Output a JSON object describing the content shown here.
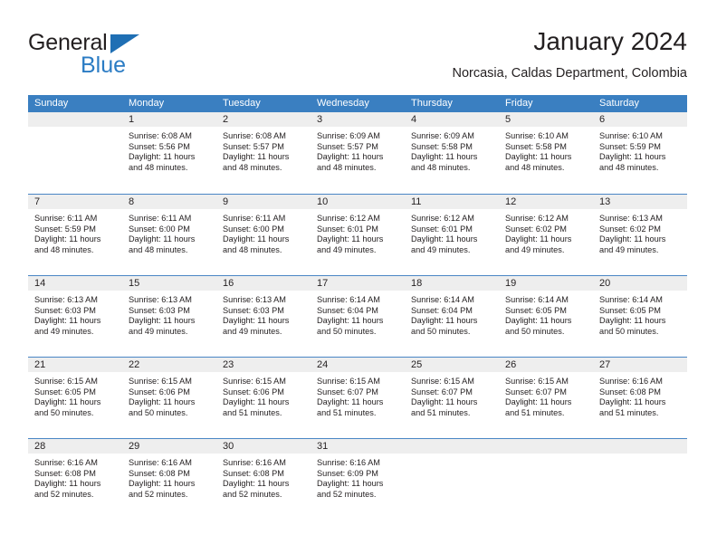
{
  "brand": {
    "name_top": "General",
    "name_bottom": "Blue",
    "triangle_icon": "brand-triangle-icon",
    "color_dark": "#231f20",
    "color_blue": "#2b7cc4"
  },
  "header": {
    "title": "January 2024",
    "subtitle": "Norcasia, Caldas Department, Colombia"
  },
  "theme": {
    "header_blue": "#3a7fc1",
    "row_divider_blue": "#4a86c5",
    "day_strip_gray": "#eeeeee",
    "text": "#231f20"
  },
  "calendar": {
    "weekday_headers": [
      "Sunday",
      "Monday",
      "Tuesday",
      "Wednesday",
      "Thursday",
      "Friday",
      "Saturday"
    ],
    "weeks": [
      [
        {
          "day": "",
          "empty": true,
          "sunrise": "",
          "sunset": "",
          "daylight_line1": "",
          "daylight_line2": ""
        },
        {
          "day": "1",
          "sunrise": "Sunrise: 6:08 AM",
          "sunset": "Sunset: 5:56 PM",
          "daylight_line1": "Daylight: 11 hours",
          "daylight_line2": "and 48 minutes."
        },
        {
          "day": "2",
          "sunrise": "Sunrise: 6:08 AM",
          "sunset": "Sunset: 5:57 PM",
          "daylight_line1": "Daylight: 11 hours",
          "daylight_line2": "and 48 minutes."
        },
        {
          "day": "3",
          "sunrise": "Sunrise: 6:09 AM",
          "sunset": "Sunset: 5:57 PM",
          "daylight_line1": "Daylight: 11 hours",
          "daylight_line2": "and 48 minutes."
        },
        {
          "day": "4",
          "sunrise": "Sunrise: 6:09 AM",
          "sunset": "Sunset: 5:58 PM",
          "daylight_line1": "Daylight: 11 hours",
          "daylight_line2": "and 48 minutes."
        },
        {
          "day": "5",
          "sunrise": "Sunrise: 6:10 AM",
          "sunset": "Sunset: 5:58 PM",
          "daylight_line1": "Daylight: 11 hours",
          "daylight_line2": "and 48 minutes."
        },
        {
          "day": "6",
          "sunrise": "Sunrise: 6:10 AM",
          "sunset": "Sunset: 5:59 PM",
          "daylight_line1": "Daylight: 11 hours",
          "daylight_line2": "and 48 minutes."
        }
      ],
      [
        {
          "day": "7",
          "sunrise": "Sunrise: 6:11 AM",
          "sunset": "Sunset: 5:59 PM",
          "daylight_line1": "Daylight: 11 hours",
          "daylight_line2": "and 48 minutes."
        },
        {
          "day": "8",
          "sunrise": "Sunrise: 6:11 AM",
          "sunset": "Sunset: 6:00 PM",
          "daylight_line1": "Daylight: 11 hours",
          "daylight_line2": "and 48 minutes."
        },
        {
          "day": "9",
          "sunrise": "Sunrise: 6:11 AM",
          "sunset": "Sunset: 6:00 PM",
          "daylight_line1": "Daylight: 11 hours",
          "daylight_line2": "and 48 minutes."
        },
        {
          "day": "10",
          "sunrise": "Sunrise: 6:12 AM",
          "sunset": "Sunset: 6:01 PM",
          "daylight_line1": "Daylight: 11 hours",
          "daylight_line2": "and 49 minutes."
        },
        {
          "day": "11",
          "sunrise": "Sunrise: 6:12 AM",
          "sunset": "Sunset: 6:01 PM",
          "daylight_line1": "Daylight: 11 hours",
          "daylight_line2": "and 49 minutes."
        },
        {
          "day": "12",
          "sunrise": "Sunrise: 6:12 AM",
          "sunset": "Sunset: 6:02 PM",
          "daylight_line1": "Daylight: 11 hours",
          "daylight_line2": "and 49 minutes."
        },
        {
          "day": "13",
          "sunrise": "Sunrise: 6:13 AM",
          "sunset": "Sunset: 6:02 PM",
          "daylight_line1": "Daylight: 11 hours",
          "daylight_line2": "and 49 minutes."
        }
      ],
      [
        {
          "day": "14",
          "sunrise": "Sunrise: 6:13 AM",
          "sunset": "Sunset: 6:03 PM",
          "daylight_line1": "Daylight: 11 hours",
          "daylight_line2": "and 49 minutes."
        },
        {
          "day": "15",
          "sunrise": "Sunrise: 6:13 AM",
          "sunset": "Sunset: 6:03 PM",
          "daylight_line1": "Daylight: 11 hours",
          "daylight_line2": "and 49 minutes."
        },
        {
          "day": "16",
          "sunrise": "Sunrise: 6:13 AM",
          "sunset": "Sunset: 6:03 PM",
          "daylight_line1": "Daylight: 11 hours",
          "daylight_line2": "and 49 minutes."
        },
        {
          "day": "17",
          "sunrise": "Sunrise: 6:14 AM",
          "sunset": "Sunset: 6:04 PM",
          "daylight_line1": "Daylight: 11 hours",
          "daylight_line2": "and 50 minutes."
        },
        {
          "day": "18",
          "sunrise": "Sunrise: 6:14 AM",
          "sunset": "Sunset: 6:04 PM",
          "daylight_line1": "Daylight: 11 hours",
          "daylight_line2": "and 50 minutes."
        },
        {
          "day": "19",
          "sunrise": "Sunrise: 6:14 AM",
          "sunset": "Sunset: 6:05 PM",
          "daylight_line1": "Daylight: 11 hours",
          "daylight_line2": "and 50 minutes."
        },
        {
          "day": "20",
          "sunrise": "Sunrise: 6:14 AM",
          "sunset": "Sunset: 6:05 PM",
          "daylight_line1": "Daylight: 11 hours",
          "daylight_line2": "and 50 minutes."
        }
      ],
      [
        {
          "day": "21",
          "sunrise": "Sunrise: 6:15 AM",
          "sunset": "Sunset: 6:05 PM",
          "daylight_line1": "Daylight: 11 hours",
          "daylight_line2": "and 50 minutes."
        },
        {
          "day": "22",
          "sunrise": "Sunrise: 6:15 AM",
          "sunset": "Sunset: 6:06 PM",
          "daylight_line1": "Daylight: 11 hours",
          "daylight_line2": "and 50 minutes."
        },
        {
          "day": "23",
          "sunrise": "Sunrise: 6:15 AM",
          "sunset": "Sunset: 6:06 PM",
          "daylight_line1": "Daylight: 11 hours",
          "daylight_line2": "and 51 minutes."
        },
        {
          "day": "24",
          "sunrise": "Sunrise: 6:15 AM",
          "sunset": "Sunset: 6:07 PM",
          "daylight_line1": "Daylight: 11 hours",
          "daylight_line2": "and 51 minutes."
        },
        {
          "day": "25",
          "sunrise": "Sunrise: 6:15 AM",
          "sunset": "Sunset: 6:07 PM",
          "daylight_line1": "Daylight: 11 hours",
          "daylight_line2": "and 51 minutes."
        },
        {
          "day": "26",
          "sunrise": "Sunrise: 6:15 AM",
          "sunset": "Sunset: 6:07 PM",
          "daylight_line1": "Daylight: 11 hours",
          "daylight_line2": "and 51 minutes."
        },
        {
          "day": "27",
          "sunrise": "Sunrise: 6:16 AM",
          "sunset": "Sunset: 6:08 PM",
          "daylight_line1": "Daylight: 11 hours",
          "daylight_line2": "and 51 minutes."
        }
      ],
      [
        {
          "day": "28",
          "sunrise": "Sunrise: 6:16 AM",
          "sunset": "Sunset: 6:08 PM",
          "daylight_line1": "Daylight: 11 hours",
          "daylight_line2": "and 52 minutes."
        },
        {
          "day": "29",
          "sunrise": "Sunrise: 6:16 AM",
          "sunset": "Sunset: 6:08 PM",
          "daylight_line1": "Daylight: 11 hours",
          "daylight_line2": "and 52 minutes."
        },
        {
          "day": "30",
          "sunrise": "Sunrise: 6:16 AM",
          "sunset": "Sunset: 6:08 PM",
          "daylight_line1": "Daylight: 11 hours",
          "daylight_line2": "and 52 minutes."
        },
        {
          "day": "31",
          "sunrise": "Sunrise: 6:16 AM",
          "sunset": "Sunset: 6:09 PM",
          "daylight_line1": "Daylight: 11 hours",
          "daylight_line2": "and 52 minutes."
        },
        {
          "day": "",
          "empty": true,
          "sunrise": "",
          "sunset": "",
          "daylight_line1": "",
          "daylight_line2": ""
        },
        {
          "day": "",
          "empty": true,
          "sunrise": "",
          "sunset": "",
          "daylight_line1": "",
          "daylight_line2": ""
        },
        {
          "day": "",
          "empty": true,
          "sunrise": "",
          "sunset": "",
          "daylight_line1": "",
          "daylight_line2": ""
        }
      ]
    ]
  }
}
